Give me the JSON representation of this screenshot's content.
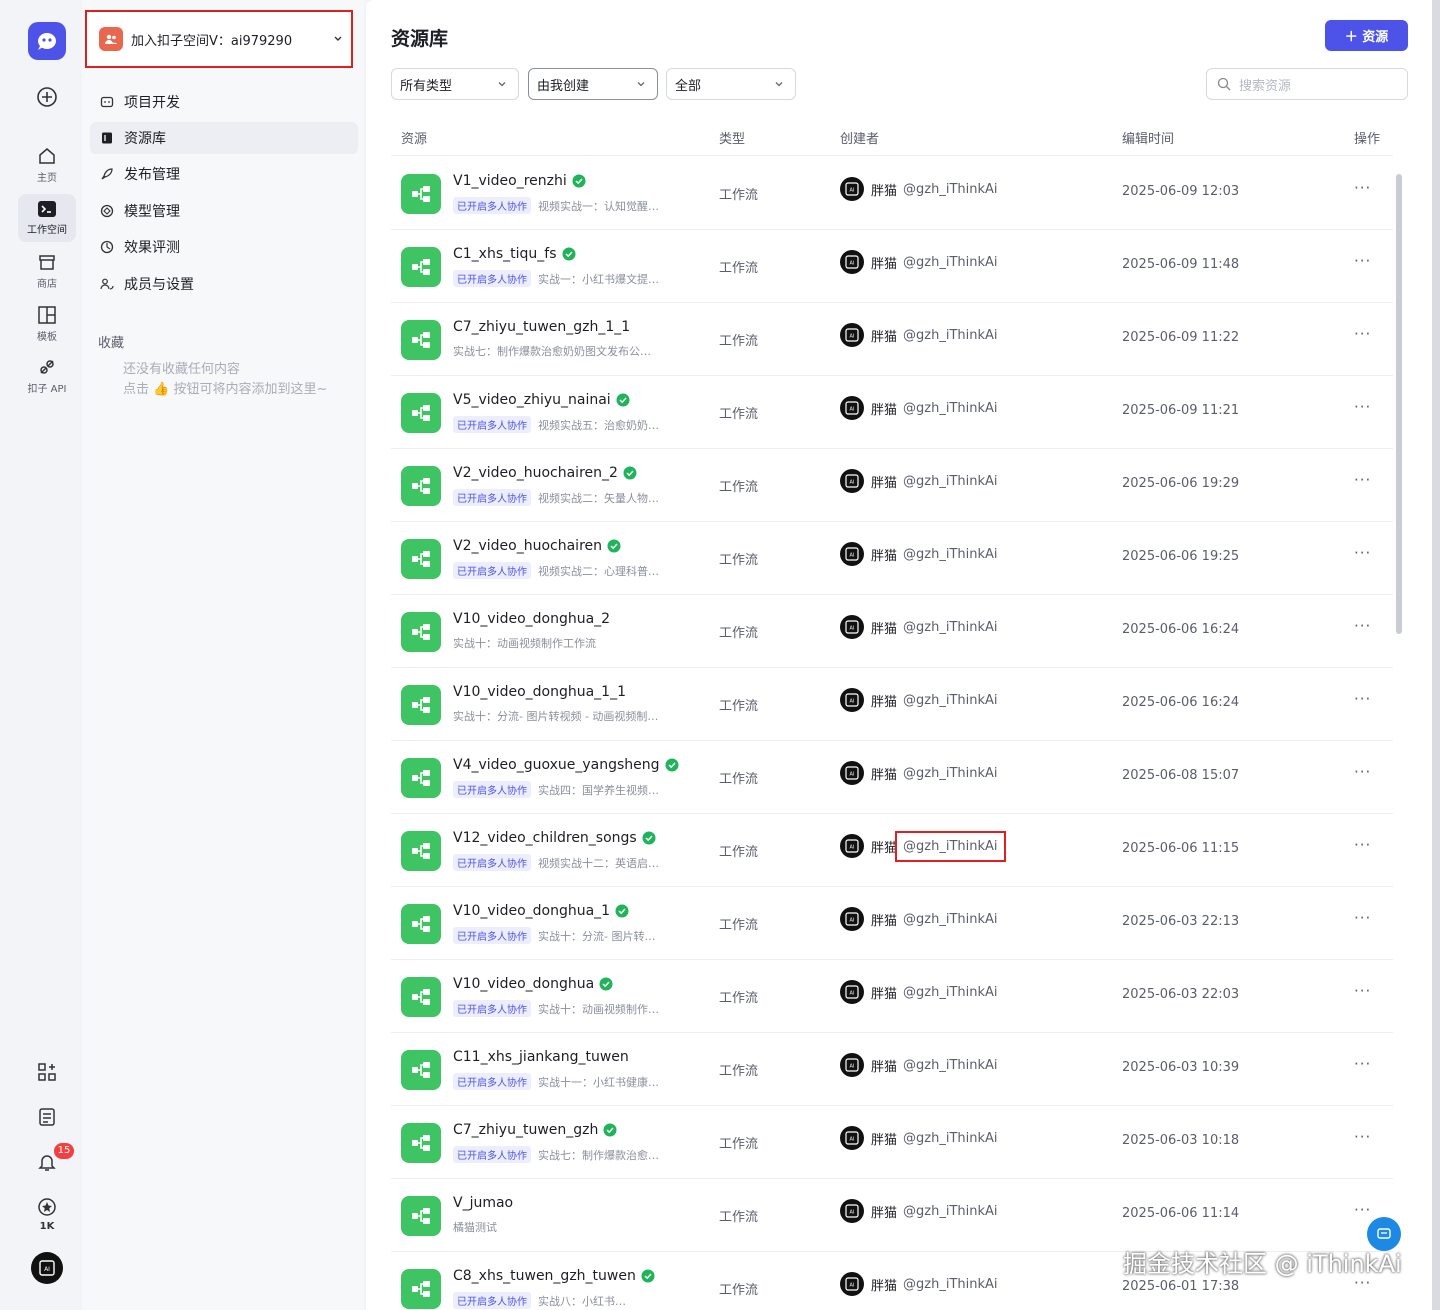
{
  "rail": {
    "items": [
      {
        "label": "主页",
        "icon": "home-icon"
      },
      {
        "label": "工作空间",
        "icon": "workspace-icon"
      },
      {
        "label": "商店",
        "icon": "store-icon"
      },
      {
        "label": "模板",
        "icon": "template-icon"
      },
      {
        "label": "扣子 API",
        "icon": "api-icon"
      }
    ],
    "notification_count": "15",
    "star_count": "1K"
  },
  "sidebar": {
    "space_label": "加入扣子空间V：ai979290",
    "nav": [
      {
        "label": "项目开发",
        "icon": "project-icon"
      },
      {
        "label": "资源库",
        "icon": "library-icon",
        "active": true
      },
      {
        "label": "发布管理",
        "icon": "rocket-icon"
      },
      {
        "label": "模型管理",
        "icon": "model-icon"
      },
      {
        "label": "效果评测",
        "icon": "eval-icon"
      },
      {
        "label": "成员与设置",
        "icon": "members-icon"
      }
    ],
    "favorites_title": "收藏",
    "favorites_empty_1": "还没有收藏任何内容",
    "favorites_empty_2": "点击 👍 按钮可将内容添加到这里~"
  },
  "main": {
    "title": "资源库",
    "add_button": "＋ 资源",
    "filters": [
      "所有类型",
      "由我创建",
      "全部"
    ],
    "search_placeholder": "搜索资源",
    "columns": [
      "资源",
      "类型",
      "创建者",
      "编辑时间",
      "操作"
    ],
    "rows": [
      {
        "name": "V1_video_renzhi",
        "verified": true,
        "tag": "已开启多人协作",
        "desc": "视频实战一：认知觉醒…",
        "type": "工作流",
        "creator": "胖猫",
        "handle": "@gzh_iThinkAi",
        "time": "2025-06-09 12:03"
      },
      {
        "name": "C1_xhs_tiqu_fs",
        "verified": true,
        "tag": "已开启多人协作",
        "desc": "实战一：小红书爆文提…",
        "type": "工作流",
        "creator": "胖猫",
        "handle": "@gzh_iThinkAi",
        "time": "2025-06-09 11:48"
      },
      {
        "name": "C7_zhiyu_tuwen_gzh_1_1",
        "verified": false,
        "tag": "",
        "desc": "实战七：制作爆款治愈奶奶图文发布公…",
        "type": "工作流",
        "creator": "胖猫",
        "handle": "@gzh_iThinkAi",
        "time": "2025-06-09 11:22"
      },
      {
        "name": "V5_video_zhiyu_nainai",
        "verified": true,
        "tag": "已开启多人协作",
        "desc": "视频实战五：治愈奶奶…",
        "type": "工作流",
        "creator": "胖猫",
        "handle": "@gzh_iThinkAi",
        "time": "2025-06-09 11:21"
      },
      {
        "name": "V2_video_huochairen_2",
        "verified": true,
        "tag": "已开启多人协作",
        "desc": "视频实战二：矢量人物…",
        "type": "工作流",
        "creator": "胖猫",
        "handle": "@gzh_iThinkAi",
        "time": "2025-06-06 19:29"
      },
      {
        "name": "V2_video_huochairen",
        "verified": true,
        "tag": "已开启多人协作",
        "desc": "视频实战二：心理科普…",
        "type": "工作流",
        "creator": "胖猫",
        "handle": "@gzh_iThinkAi",
        "time": "2025-06-06 19:25"
      },
      {
        "name": "V10_video_donghua_2",
        "verified": false,
        "tag": "",
        "desc": "实战十：动画视频制作工作流",
        "type": "工作流",
        "creator": "胖猫",
        "handle": "@gzh_iThinkAi",
        "time": "2025-06-06 16:24"
      },
      {
        "name": "V10_video_donghua_1_1",
        "verified": false,
        "tag": "",
        "desc": "实战十：分流- 图片转视频 - 动画视频制…",
        "type": "工作流",
        "creator": "胖猫",
        "handle": "@gzh_iThinkAi",
        "time": "2025-06-06 16:24"
      },
      {
        "name": "V4_video_guoxue_yangsheng",
        "verified": true,
        "tag": "已开启多人协作",
        "desc": "实战四：国学养生视频…",
        "type": "工作流",
        "creator": "胖猫",
        "handle": "@gzh_iThinkAi",
        "time": "2025-06-08 15:07"
      },
      {
        "name": "V12_video_children_songs",
        "verified": true,
        "tag": "已开启多人协作",
        "desc": "视频实战十二：英语启…",
        "type": "工作流",
        "creator": "胖猫",
        "handle": "@gzh_iThinkAi",
        "time": "2025-06-06 11:15",
        "highlight": true
      },
      {
        "name": "V10_video_donghua_1",
        "verified": true,
        "tag": "已开启多人协作",
        "desc": "实战十：分流- 图片转…",
        "type": "工作流",
        "creator": "胖猫",
        "handle": "@gzh_iThinkAi",
        "time": "2025-06-03 22:13"
      },
      {
        "name": "V10_video_donghua",
        "verified": true,
        "tag": "已开启多人协作",
        "desc": "实战十：动画视频制作…",
        "type": "工作流",
        "creator": "胖猫",
        "handle": "@gzh_iThinkAi",
        "time": "2025-06-03 22:03"
      },
      {
        "name": "C11_xhs_jiankang_tuwen",
        "verified": false,
        "tag": "已开启多人协作",
        "desc": "实战十一：小红书健康…",
        "type": "工作流",
        "creator": "胖猫",
        "handle": "@gzh_iThinkAi",
        "time": "2025-06-03 10:39"
      },
      {
        "name": "C7_zhiyu_tuwen_gzh",
        "verified": true,
        "tag": "已开启多人协作",
        "desc": "实战七：制作爆款治愈…",
        "type": "工作流",
        "creator": "胖猫",
        "handle": "@gzh_iThinkAi",
        "time": "2025-06-03 10:18"
      },
      {
        "name": "V_jumao",
        "verified": false,
        "tag": "",
        "desc": "橘猫测试",
        "type": "工作流",
        "creator": "胖猫",
        "handle": "@gzh_iThinkAi",
        "time": "2025-06-06 11:14"
      },
      {
        "name": "C8_xhs_tuwen_gzh_tuwen",
        "verified": true,
        "tag": "已开启多人协作",
        "desc": "实战八：小红书…",
        "type": "工作流",
        "creator": "胖猫",
        "handle": "@gzh_iThinkAi",
        "time": "2025-06-01 17:38"
      }
    ],
    "more_label": "···"
  },
  "watermark": "掘金技术社区 @ iThinkAi",
  "colors": {
    "accent": "#4d53e8",
    "workflow_green": "#3ec462",
    "highlight_red": "#e02020"
  }
}
